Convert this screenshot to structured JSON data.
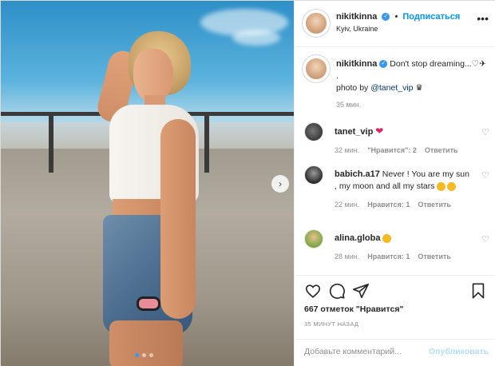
{
  "post": {
    "username": "nikitkinna",
    "follow_label": "Подписаться",
    "location": "Kyiv, Ukraine",
    "more_icon": "ellipsis-icon",
    "caption": {
      "text": "Don't stop dreaming...♡✈",
      "dot_line": ".",
      "photo_by_prefix": "photo by",
      "photo_by_handle": "@tanet_vip",
      "photo_by_suffix": "♛",
      "time": "35 мин."
    },
    "carousel": {
      "total": 3,
      "active": 1
    }
  },
  "comments": [
    {
      "username": "tanet_vip",
      "text": "❤",
      "time": "32 мин.",
      "likes": "\"Нравится\": 2",
      "reply": "Ответить"
    },
    {
      "username": "babich.a17",
      "text": "Never ! You are my sun , my moon and all my stars",
      "time": "22 мин.",
      "likes": "Нравится: 1",
      "reply": "Ответить"
    },
    {
      "username": "alina.globa",
      "text": "",
      "time": "28 мин.",
      "likes": "Нравится: 1",
      "reply": "Ответить"
    }
  ],
  "actions": {
    "like_count": "667 отметок \"Нравится\"",
    "posted": "35 МИНУТ НАЗАД"
  },
  "add_comment": {
    "placeholder": "Добавьте комментарий...",
    "post_label": "Опубликовать"
  },
  "colors": {
    "accent": "#0095f6",
    "verified": "#3897f0",
    "muted": "#8e8e8e",
    "heart": "#e0245e"
  }
}
